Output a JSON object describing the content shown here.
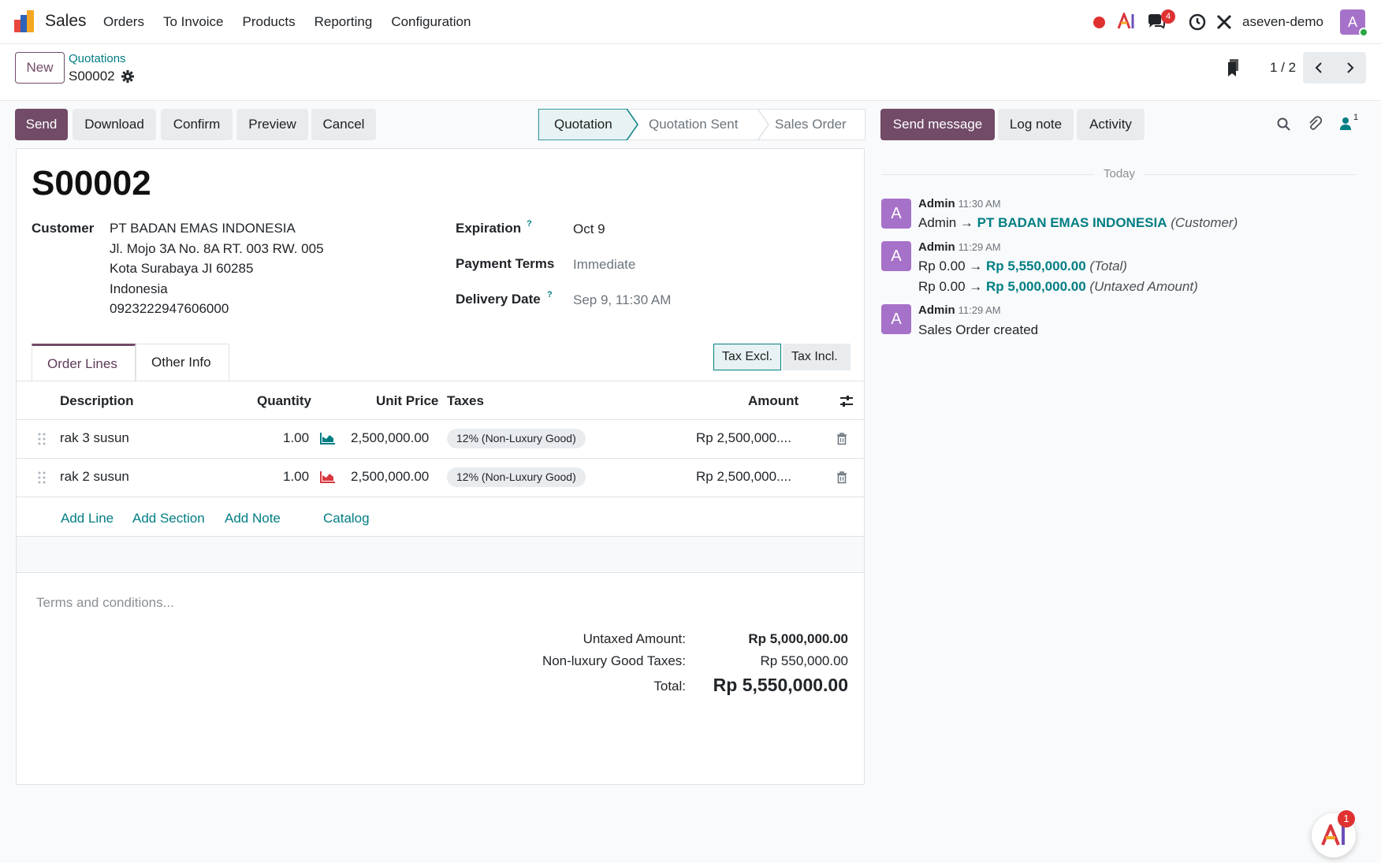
{
  "app": {
    "name": "Sales"
  },
  "menu": [
    "Orders",
    "To Invoice",
    "Products",
    "Reporting",
    "Configuration"
  ],
  "systray": {
    "messages_badge": "4",
    "user": "aseven-demo",
    "avatar_letter": "A"
  },
  "breadcrumb": {
    "new_label": "New",
    "parent": "Quotations",
    "current": "S00002"
  },
  "pager": {
    "value": "1 / 2"
  },
  "actions": {
    "send": "Send",
    "download": "Download",
    "confirm": "Confirm",
    "preview": "Preview",
    "cancel": "Cancel"
  },
  "statusbar": [
    "Quotation",
    "Quotation Sent",
    "Sales Order"
  ],
  "record": {
    "title": "S00002",
    "customer_label": "Customer",
    "customer_lines": [
      "PT BADAN EMAS INDONESIA",
      "Jl. Mojo 3A No. 8A RT. 003 RW. 005",
      "Kota Surabaya JI 60285",
      "Indonesia",
      "0923222947606000"
    ],
    "expiration_label": "Expiration",
    "expiration_value": "Oct 9",
    "payment_terms_label": "Payment Terms",
    "payment_terms_value": "Immediate",
    "delivery_date_label": "Delivery Date",
    "delivery_date_value": "Sep 9, 11:30 AM"
  },
  "tabs": [
    "Order Lines",
    "Other Info"
  ],
  "tax_toggle": [
    "Tax Excl.",
    "Tax Incl."
  ],
  "table": {
    "headers": {
      "description": "Description",
      "quantity": "Quantity",
      "unit_price": "Unit Price",
      "taxes": "Taxes",
      "amount": "Amount"
    },
    "rows": [
      {
        "description": "rak 3 susun",
        "quantity": "1.00",
        "unit_price": "2,500,000.00",
        "tax": "12% (Non-Luxury Good)",
        "amount": "Rp 2,500,000....",
        "chart_color": "#017e84"
      },
      {
        "description": "rak 2 susun",
        "quantity": "1.00",
        "unit_price": "2,500,000.00",
        "tax": "12% (Non-Luxury Good)",
        "amount": "Rp 2,500,000....",
        "chart_color": "#d9363e"
      }
    ],
    "add_links": {
      "add_line": "Add Line",
      "add_section": "Add Section",
      "add_note": "Add Note",
      "catalog": "Catalog"
    }
  },
  "terms_placeholder": "Terms and conditions...",
  "totals": {
    "untaxed_label": "Untaxed Amount:",
    "untaxed_value": "Rp 5,000,000.00",
    "taxes_label": "Non-luxury Good Taxes:",
    "taxes_value": "Rp 550,000.00",
    "total_label": "Total:",
    "total_value": "Rp 5,550,000.00"
  },
  "chatter": {
    "send_message": "Send message",
    "log_note": "Log note",
    "activity": "Activity",
    "followers_count": "1",
    "date_separator": "Today",
    "messages": [
      {
        "author": "Admin",
        "time": "11:30 AM",
        "lines": [
          {
            "old": "Admin",
            "new": "PT BADAN EMAS INDONESIA",
            "field": "(Customer)"
          }
        ]
      },
      {
        "author": "Admin",
        "time": "11:29 AM",
        "lines": [
          {
            "old": "Rp 0.00",
            "new": "Rp 5,550,000.00",
            "field": "(Total)"
          },
          {
            "old": "Rp 0.00",
            "new": "Rp 5,000,000.00",
            "field": "(Untaxed Amount)"
          }
        ]
      },
      {
        "author": "Admin",
        "time": "11:29 AM",
        "text": "Sales Order created"
      }
    ]
  },
  "fab_badge": "1"
}
